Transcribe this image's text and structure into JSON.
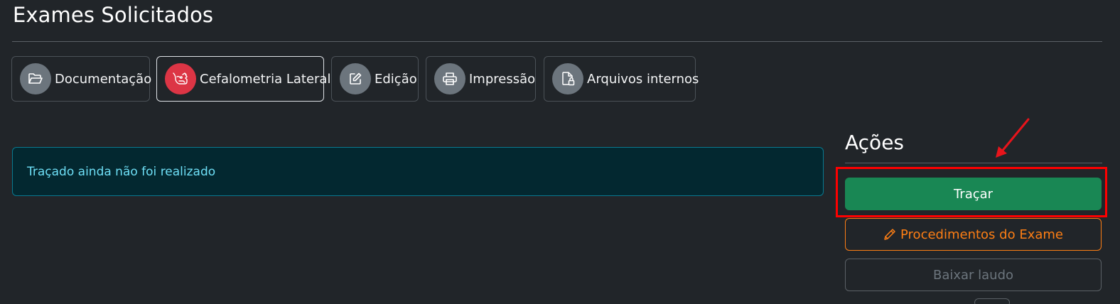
{
  "header": {
    "title": "Exames Solicitados"
  },
  "tabs": [
    {
      "label": "Documentação",
      "icon": "folder-open-icon",
      "active": false
    },
    {
      "label": "Cefalometria Lateral",
      "icon": "cephalometry-icon",
      "active": true
    },
    {
      "label": "Edição",
      "icon": "edit-icon",
      "active": false
    },
    {
      "label": "Impressão",
      "icon": "printer-icon",
      "active": false
    },
    {
      "label": "Arquivos internos",
      "icon": "file-lock-icon",
      "active": false
    }
  ],
  "alert": {
    "message": "Traçado ainda não foi realizado"
  },
  "actions": {
    "title": "Ações",
    "tracar_label": "Traçar",
    "procedimentos_label": "Procedimentos do Exame",
    "baixar_label": "Baixar laudo"
  },
  "colors": {
    "background": "#212529",
    "success": "#198754",
    "warning": "#fd7e14",
    "info_text": "#6edff6",
    "danger": "#dc3545",
    "annotation": "#ff0000"
  }
}
